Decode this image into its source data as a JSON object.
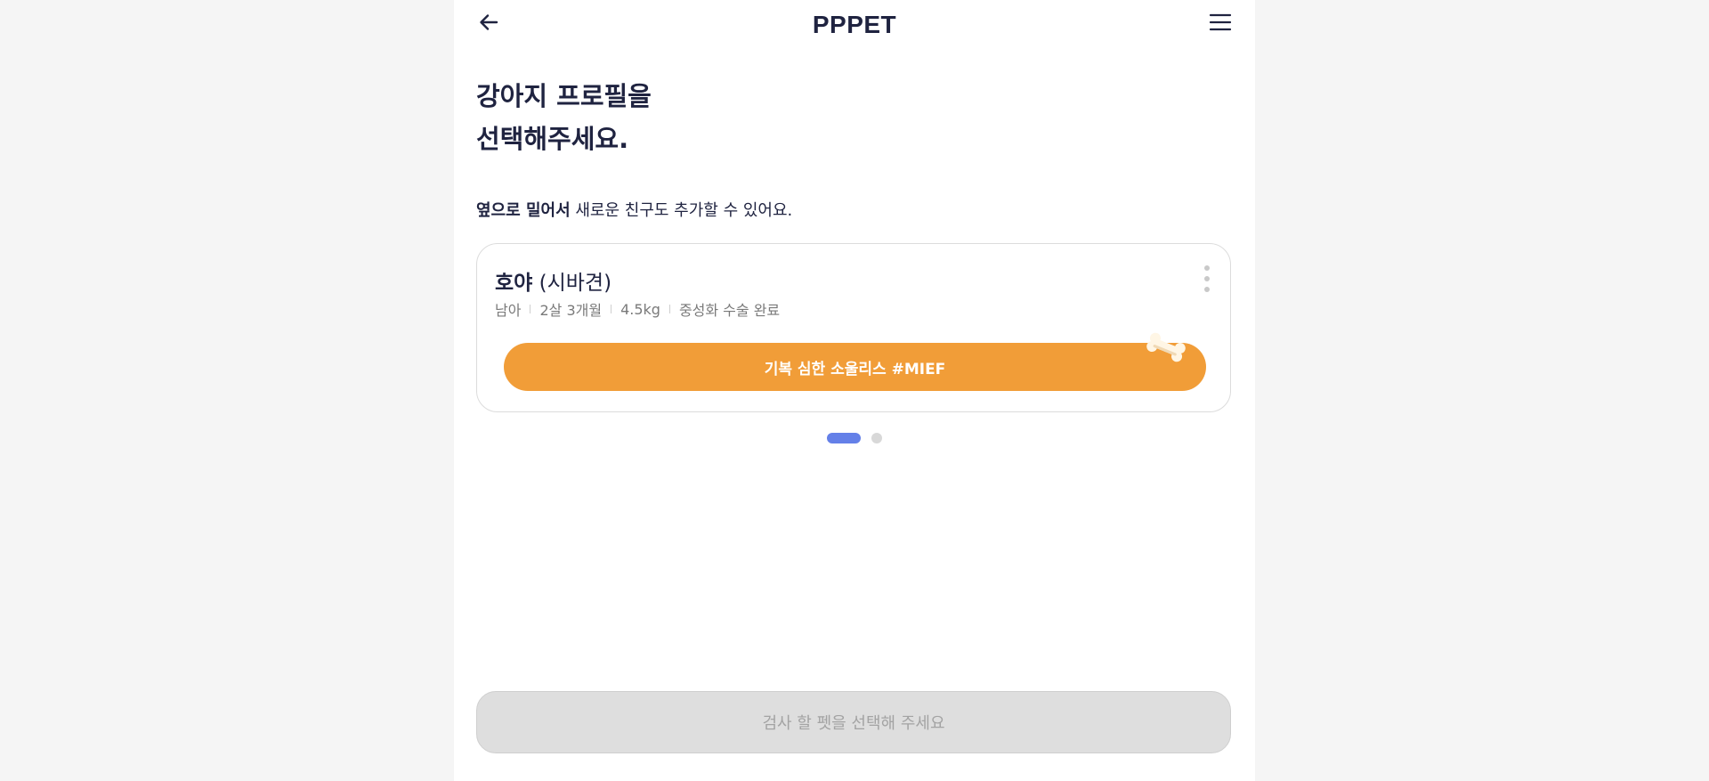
{
  "header": {
    "logo": "PPPET",
    "back_icon": "arrow-left-icon",
    "menu_icon": "hamburger-menu-icon"
  },
  "title": {
    "line1": "강아지 프로필을",
    "line2": "선택해주세요."
  },
  "hint": {
    "bold": "옆으로 밀어서",
    "rest": " 새로운 친구도 추가할 수 있어요."
  },
  "pet": {
    "name": "호야",
    "breed": "(시바견)",
    "gender": "남아",
    "age": "2살 3개월",
    "weight": "4.5kg",
    "neutered": "중성화 수술 완료",
    "tag_button": "기복 심한 소울리스 #MIEF",
    "more_icon": "more-vertical-icon",
    "decoration_icon": "bone-icon"
  },
  "pager": {
    "total": 2,
    "active": 1
  },
  "submit": {
    "label": "검사 할 펫을 선택해 주세요",
    "enabled": false
  },
  "colors": {
    "accent_orange": "#f19d38",
    "pager_active": "#6480e8",
    "text_dark": "#1f2340",
    "disabled_bg": "#dedede"
  }
}
